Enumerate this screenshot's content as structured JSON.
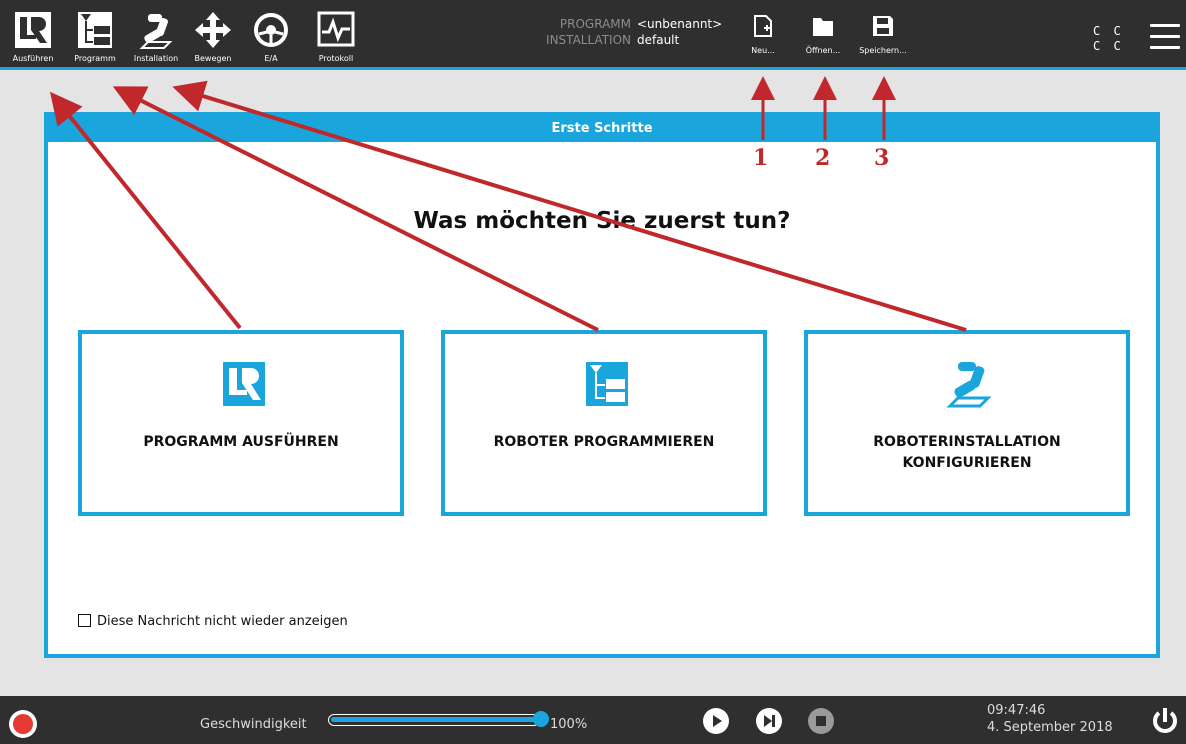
{
  "topbar": {
    "nav": [
      {
        "label": "Ausführen",
        "icon": "ur-logo-icon"
      },
      {
        "label": "Programm",
        "icon": "program-tree-icon"
      },
      {
        "label": "Installation",
        "icon": "robot-arm-icon"
      },
      {
        "label": "Bewegen",
        "icon": "move-arrows-icon"
      },
      {
        "label": "E/A",
        "icon": "io-dial-icon"
      },
      {
        "label": "Protokoll",
        "icon": "log-graph-icon"
      }
    ],
    "program_key": "PROGRAMM",
    "program_value": "<unbenannt>",
    "installation_key": "INSTALLATION",
    "installation_value": "default",
    "file_buttons": [
      {
        "label": "Neu...",
        "icon": "new-file-icon"
      },
      {
        "label": "Öffnen...",
        "icon": "folder-icon"
      },
      {
        "label": "Speichern...",
        "icon": "save-disk-icon"
      }
    ],
    "status_chars": [
      "C C",
      "C C"
    ]
  },
  "dialog": {
    "title": "Erste Schritte",
    "question": "Was möchten Sie zuerst tun?",
    "cards": [
      {
        "label": "PROGRAMM AUSFÜHREN",
        "icon": "ur-logo-icon"
      },
      {
        "label": "ROBOTER PROGRAMMIEREN",
        "icon": "program-tree-icon"
      },
      {
        "label_line1": "ROBOTERINSTALLATION",
        "label_line2": "KONFIGURIEREN",
        "icon": "robot-arm-icon"
      }
    ],
    "dont_show_label": "Diese Nachricht nicht wieder anzeigen"
  },
  "bottombar": {
    "speed_label": "Geschwindigkeit",
    "speed_value": "100%",
    "speed_fraction": 1.0,
    "time": "09:47:46",
    "date": "4. September 2018"
  },
  "annotations": {
    "numbers": [
      "1",
      "2",
      "3"
    ],
    "arrow_color": "#c0282c"
  },
  "colors": {
    "accent": "#1aa6dc",
    "bar_bg": "#2f2f2f",
    "record": "#e53935"
  }
}
